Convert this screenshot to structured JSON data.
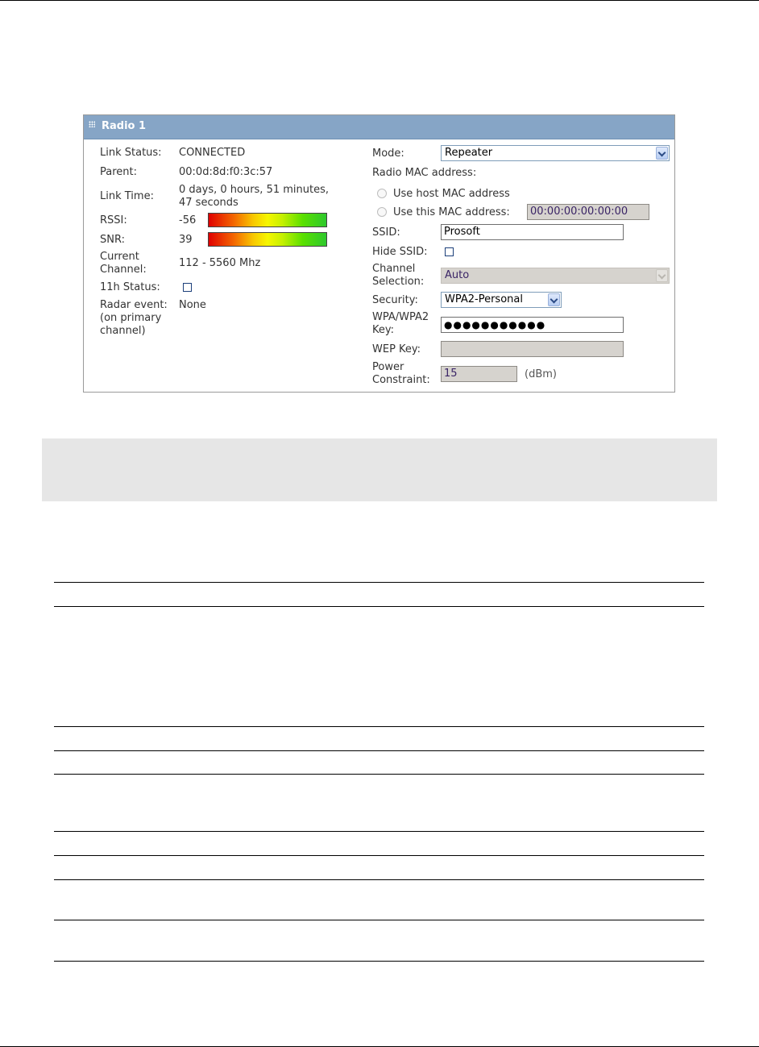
{
  "panel": {
    "title": "Radio 1",
    "left": {
      "link_status_label": "Link Status:",
      "link_status_value": "CONNECTED",
      "parent_label": "Parent:",
      "parent_value": "00:0d:8d:f0:3c:57",
      "link_time_label": "Link Time:",
      "link_time_line1": "0 days, 0 hours, 51 minutes,",
      "link_time_line2": "47 seconds",
      "rssi_label": "RSSI:",
      "rssi_value": "-56",
      "rssi_level": 1.0,
      "snr_label": "SNR:",
      "snr_value": "39",
      "snr_level": 1.0,
      "current_channel_line1": "Current",
      "current_channel_line2": "Channel:",
      "current_channel_value": "112 - 5560 Mhz",
      "h11_status_label": "11h Status:",
      "h11_status_checked": false,
      "radar_line1": "Radar event:",
      "radar_line2": "(on primary",
      "radar_line3": "channel)",
      "radar_value": "None"
    },
    "right": {
      "mode_label": "Mode:",
      "mode_value": "Repeater",
      "radio_mac_label": "Radio MAC address:",
      "use_host_mac_label": "Use host MAC address",
      "use_this_mac_label": "Use this MAC address:",
      "mac_value": "00:00:00:00:00:00",
      "ssid_label": "SSID:",
      "ssid_value": "Prosoft",
      "hide_ssid_label": "Hide SSID:",
      "hide_ssid_checked": false,
      "channel_selection_line1": "Channel",
      "channel_selection_line2": "Selection:",
      "channel_selection_value": "Auto",
      "security_label": "Security:",
      "security_value": "WPA2-Personal",
      "wpa_key_line1": "WPA/WPA2",
      "wpa_key_line2": "Key:",
      "wpa_key_value": "●●●●●●●●●●●",
      "wep_key_label": "WEP Key:",
      "wep_key_value": "",
      "power_line1": "Power",
      "power_line2": "Constraint:",
      "power_value": "15",
      "power_unit": "(dBm)"
    }
  },
  "colors": {
    "header_bg": "#86a5c6",
    "disabled_field": "#d6d3ce",
    "gray_block": "#e6e6e6"
  }
}
